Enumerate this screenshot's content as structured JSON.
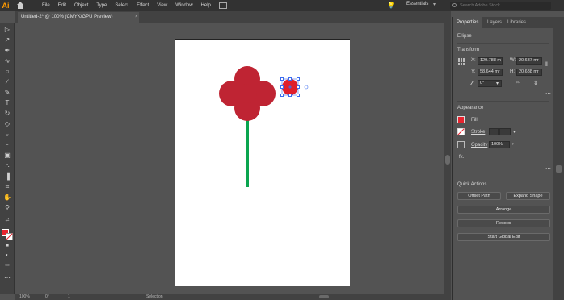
{
  "app": {
    "logo": "Ai",
    "menu": [
      "File",
      "Edit",
      "Object",
      "Type",
      "Select",
      "Effect",
      "View",
      "Window",
      "Help"
    ],
    "workspace": "Essentials",
    "search_placeholder": "Search Adobe Stock"
  },
  "document": {
    "tab_title": "Untitled-2* @ 100% (CMYK/GPU Preview)",
    "close_glyph": "×"
  },
  "colors": {
    "petal": "#bf2433",
    "selected_circle": "#e01f2c",
    "stem": "#0aa54f",
    "selection": "#3c6cf0",
    "fill": "#e8242f"
  },
  "panel": {
    "tabs": [
      "Properties",
      "Layers",
      "Libraries"
    ],
    "object_type": "Ellipse",
    "transform": {
      "heading": "Transform",
      "x_label": "X:",
      "x_value": "129.788 m",
      "y_label": "Y:",
      "y_value": "58.644 mr",
      "w_label": "W:",
      "w_value": "20.637 mr",
      "h_label": "H:",
      "h_value": "20.638 mr",
      "angle_value": "0°"
    },
    "appearance": {
      "heading": "Appearance",
      "fill_label": "Fill",
      "stroke_label": "Stroke",
      "opacity_label": "Opacity",
      "opacity_value": "100%",
      "fx_label": "fx."
    },
    "quick_actions": {
      "heading": "Quick Actions",
      "offset_path": "Offset Path",
      "expand_shape": "Expand Shape",
      "arrange": "Arrange",
      "recolor": "Recolor",
      "start_global_edit": "Start Global Edit"
    }
  },
  "status": {
    "zoom": "100%",
    "angle": "0°",
    "page": "1",
    "tool": "Selection"
  }
}
